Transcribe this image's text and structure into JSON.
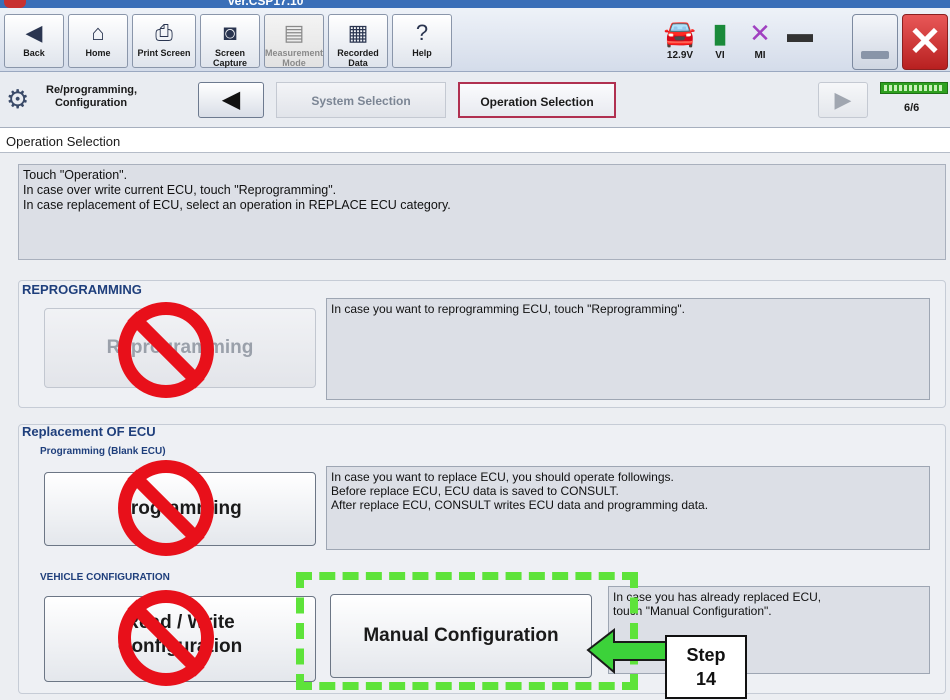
{
  "app": {
    "version": "ver.CSP17.10"
  },
  "toolbar": {
    "buttons": [
      {
        "label": "Back",
        "icon": "back-arrow-icon",
        "glyph": "◀"
      },
      {
        "label": "Home",
        "icon": "home-icon",
        "glyph": "⌂"
      },
      {
        "label": "Print Screen",
        "icon": "printer-icon",
        "glyph": "⎙"
      },
      {
        "label": "Screen Capture",
        "icon": "camera-icon",
        "glyph": "◙"
      },
      {
        "label": "Measurement Mode",
        "icon": "measurement-icon",
        "glyph": "▤"
      },
      {
        "label": "Recorded Data",
        "icon": "recorded-data-icon",
        "glyph": "▦"
      },
      {
        "label": "Help",
        "icon": "help-icon",
        "glyph": "?"
      }
    ],
    "status": {
      "battery_voltage": "12.9V",
      "vi_label": "VI",
      "mi_label": "MI"
    }
  },
  "nav": {
    "title": "Re/programming, Configuration",
    "crumb_system": "System Selection",
    "crumb_operation": "Operation Selection",
    "page_count": "6/6"
  },
  "page": {
    "section_title": "Operation Selection",
    "instructions": [
      "Touch \"Operation\".",
      "In case over write current ECU, touch \"Reprogramming\".",
      "In case replacement of ECU, select an operation in REPLACE ECU category."
    ]
  },
  "reprogramming": {
    "group_title": "REPROGRAMMING",
    "button_label": "Reprogramming",
    "description": "In case you want to reprogramming ECU, touch \"Reprogramming\"."
  },
  "replacement": {
    "group_title": "Replacement OF ECU",
    "programming_subtitle": "Programming (Blank ECU)",
    "programming_button": "Programming",
    "programming_description": [
      "In case you want to replace ECU, you should operate followings.",
      "Before replace ECU, ECU data is saved to CONSULT.",
      "After replace ECU, CONSULT writes ECU data and programming data."
    ],
    "vehicle_config_subtitle": "VEHICLE CONFIGURATION",
    "read_write_line1": "Read / Write",
    "read_write_line2": "Configuration",
    "manual_config_button": "Manual Configuration",
    "manual_config_description": [
      "In case you has already replaced ECU,",
      "touch \"Manual Configuration\"."
    ]
  },
  "annotation": {
    "step_word": "Step",
    "step_number": "14",
    "highlight_color": "#5ee33a",
    "prohibit_color": "#e8101a"
  }
}
